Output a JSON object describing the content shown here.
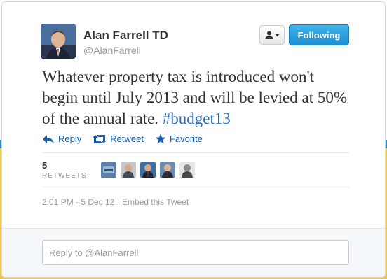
{
  "tweet": {
    "author": {
      "name": "Alan Farrell TD",
      "handle": "@AlanFarrell"
    },
    "buttons": {
      "follow_label": "Following"
    },
    "text_main": "Whatever property tax is introduced won't begin until July 2013 and will be levied at 50% of the annual rate. ",
    "hashtag": "#budget13",
    "actions": {
      "reply": "Reply",
      "retweet": "Retweet",
      "favorite": "Favorite"
    },
    "stats": {
      "retweet_count": "5",
      "retweet_label": "RETWEETS"
    },
    "meta": "2:01 PM - 5 Dec 12 · Embed this Tweet",
    "reply_placeholder": "Reply to @AlanFarrell"
  },
  "colors": {
    "link": "#1b5fa8",
    "hashtag": "#2a6ebb",
    "follow_button": "#2aa3e1"
  },
  "icons": [
    "user-icon",
    "caret-down-icon",
    "reply-icon",
    "retweet-icon",
    "star-icon"
  ]
}
